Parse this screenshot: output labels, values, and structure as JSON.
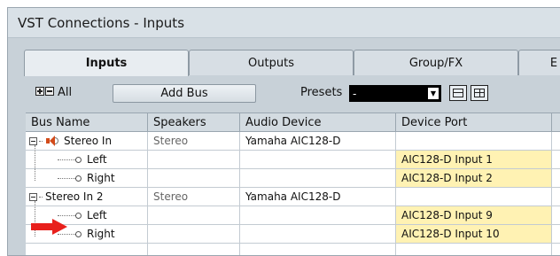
{
  "window": {
    "title": "VST Connections - Inputs"
  },
  "tabs": [
    {
      "label": "Inputs",
      "active": true
    },
    {
      "label": "Outputs",
      "active": false
    },
    {
      "label": "Group/FX",
      "active": false
    },
    {
      "label": "E",
      "active": false
    }
  ],
  "toolbar": {
    "all_label": "All",
    "add_bus_label": "Add Bus",
    "presets_label": "Presets",
    "presets_value": "-"
  },
  "columns": [
    "Bus Name",
    "Speakers",
    "Audio Device",
    "Device Port"
  ],
  "rows": [
    {
      "bus": "Stereo In",
      "speakers": "Stereo",
      "device": "Yamaha AIC128-D",
      "port": ""
    },
    {
      "bus": "Left",
      "speakers": "",
      "device": "",
      "port": "AIC128-D Input 1"
    },
    {
      "bus": "Right",
      "speakers": "",
      "device": "",
      "port": "AIC128-D Input 2"
    },
    {
      "bus": "Stereo In 2",
      "speakers": "Stereo",
      "device": "Yamaha AIC128-D",
      "port": ""
    },
    {
      "bus": "Left",
      "speakers": "",
      "device": "",
      "port": "AIC128-D Input 9"
    },
    {
      "bus": "Right",
      "speakers": "",
      "device": "",
      "port": "AIC128-D Input 10"
    }
  ],
  "colors": {
    "window_bg": "#c8d1d8",
    "port_highlight": "#fff2b3",
    "arrow": "#e8201c",
    "speaker_icon": "#d24b1a"
  },
  "icons": [
    "expand-all-icon",
    "collapse-all-icon",
    "speaker-icon",
    "dropdown-arrow-icon",
    "load-preset-icon",
    "store-preset-icon",
    "red-arrow-icon"
  ]
}
